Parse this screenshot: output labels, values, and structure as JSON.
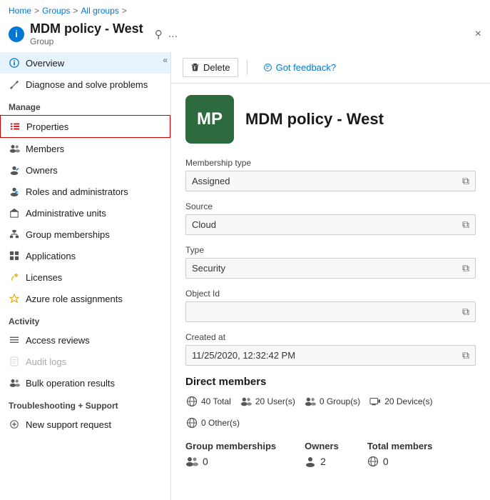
{
  "breadcrumb": {
    "items": [
      "Home",
      "Groups",
      "All groups"
    ],
    "separators": [
      ">",
      ">"
    ]
  },
  "header": {
    "icon": "i",
    "title": "MDM policy - West",
    "subtitle": "Group",
    "pin_icon": "📌",
    "more_icon": "...",
    "close_icon": "×"
  },
  "toolbar": {
    "delete_label": "Delete",
    "feedback_label": "Got feedback?"
  },
  "sidebar": {
    "collapse_icon": "«",
    "items_top": [
      {
        "id": "overview",
        "label": "Overview",
        "icon": "info",
        "active": true
      },
      {
        "id": "diagnose",
        "label": "Diagnose and solve problems",
        "icon": "wrench"
      }
    ],
    "manage_label": "Manage",
    "items_manage": [
      {
        "id": "properties",
        "label": "Properties",
        "icon": "bars",
        "selected": true
      },
      {
        "id": "members",
        "label": "Members",
        "icon": "users"
      },
      {
        "id": "owners",
        "label": "Owners",
        "icon": "user-shield"
      },
      {
        "id": "roles",
        "label": "Roles and administrators",
        "icon": "user-tag"
      },
      {
        "id": "admin-units",
        "label": "Administrative units",
        "icon": "building"
      },
      {
        "id": "group-memberships",
        "label": "Group memberships",
        "icon": "sitemap"
      },
      {
        "id": "applications",
        "label": "Applications",
        "icon": "apps"
      },
      {
        "id": "licenses",
        "label": "Licenses",
        "icon": "key"
      },
      {
        "id": "azure-role",
        "label": "Azure role assignments",
        "icon": "award"
      }
    ],
    "activity_label": "Activity",
    "items_activity": [
      {
        "id": "access-reviews",
        "label": "Access reviews",
        "icon": "list"
      },
      {
        "id": "audit-logs",
        "label": "Audit logs",
        "icon": "file",
        "disabled": true
      },
      {
        "id": "bulk-results",
        "label": "Bulk operation results",
        "icon": "users-cog"
      }
    ],
    "support_label": "Troubleshooting + Support",
    "items_support": [
      {
        "id": "new-support",
        "label": "New support request",
        "icon": "plus-circle"
      }
    ]
  },
  "group": {
    "avatar_text": "MP",
    "name": "MDM policy - West"
  },
  "fields": {
    "membership_type": {
      "label": "Membership type",
      "value": "Assigned"
    },
    "source": {
      "label": "Source",
      "value": "Cloud"
    },
    "type": {
      "label": "Type",
      "value": "Security"
    },
    "object_id": {
      "label": "Object Id",
      "value": ""
    },
    "created_at": {
      "label": "Created at",
      "value": "11/25/2020, 12:32:42 PM"
    }
  },
  "direct_members": {
    "title": "Direct members",
    "total": "40 Total",
    "users": "20 User(s)",
    "groups": "0 Group(s)",
    "devices": "20 Device(s)",
    "others": "0 Other(s)"
  },
  "bottom_stats": [
    {
      "label": "Group memberships",
      "value": "0",
      "icon": "users"
    },
    {
      "label": "Owners",
      "value": "2",
      "icon": "user-shield"
    },
    {
      "label": "Total members",
      "value": "0",
      "icon": "globe"
    }
  ]
}
